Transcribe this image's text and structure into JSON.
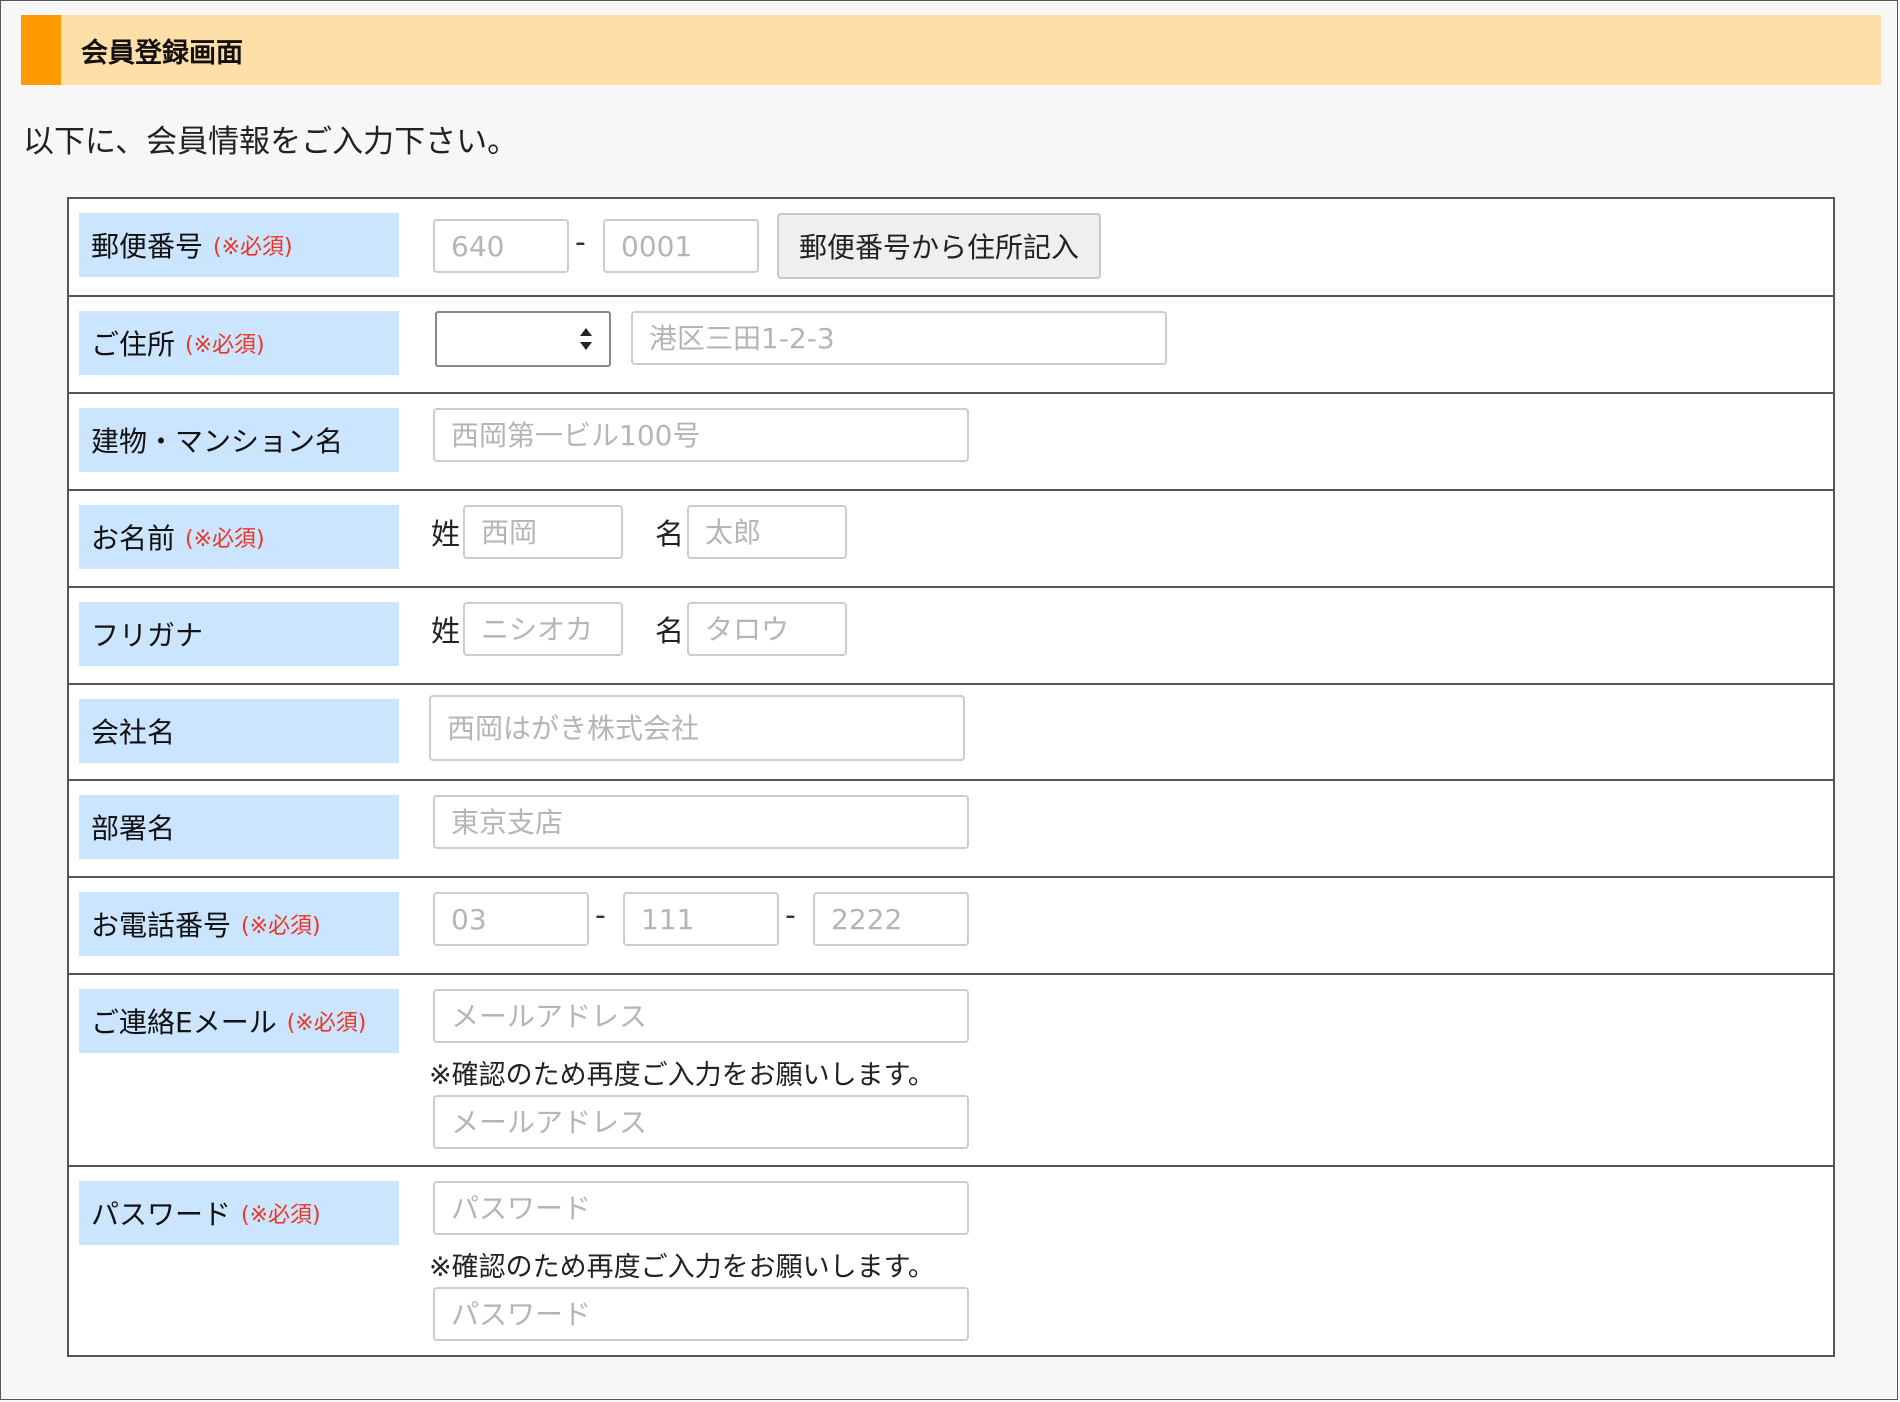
{
  "header": {
    "title": "会員登録画面"
  },
  "intro": "以下に、会員情報をご入力下さい。",
  "required_mark": "(※必須)",
  "postal": {
    "label": "郵便番号",
    "part1_placeholder": "640",
    "part2_placeholder": "0001",
    "separator": "-",
    "lookup_button": "郵便番号から住所記入"
  },
  "address": {
    "label": "ご住所",
    "prefecture_value": "",
    "street_placeholder": "港区三田1-2-3"
  },
  "building": {
    "label": "建物・マンション名",
    "placeholder": "西岡第一ビル100号"
  },
  "name": {
    "label": "お名前",
    "last_label": "姓",
    "last_placeholder": "西岡",
    "first_label": "名",
    "first_placeholder": "太郎"
  },
  "furigana": {
    "label": "フリガナ",
    "last_label": "姓",
    "last_placeholder": "ニシオカ",
    "first_label": "名",
    "first_placeholder": "タロウ"
  },
  "company": {
    "label": "会社名",
    "placeholder": "西岡はがき株式会社"
  },
  "department": {
    "label": "部署名",
    "placeholder": "東京支店"
  },
  "phone": {
    "label": "お電話番号",
    "part1_placeholder": "03",
    "part2_placeholder": "111",
    "part3_placeholder": "2222",
    "separator": "-"
  },
  "email": {
    "label": "ご連絡Eメール",
    "placeholder": "メールアドレス",
    "confirm_note": "※確認のため再度ご入力をお願いします。",
    "confirm_placeholder": "メールアドレス"
  },
  "password": {
    "label": "パスワード",
    "placeholder": "パスワード",
    "confirm_note": "※確認のため再度ご入力をお願いします。",
    "confirm_placeholder": "パスワード"
  },
  "colors": {
    "header_bg": "#ffdfa8",
    "header_accent": "#ff9a00",
    "label_bg": "#cce5ff",
    "required": "#ee3322"
  }
}
